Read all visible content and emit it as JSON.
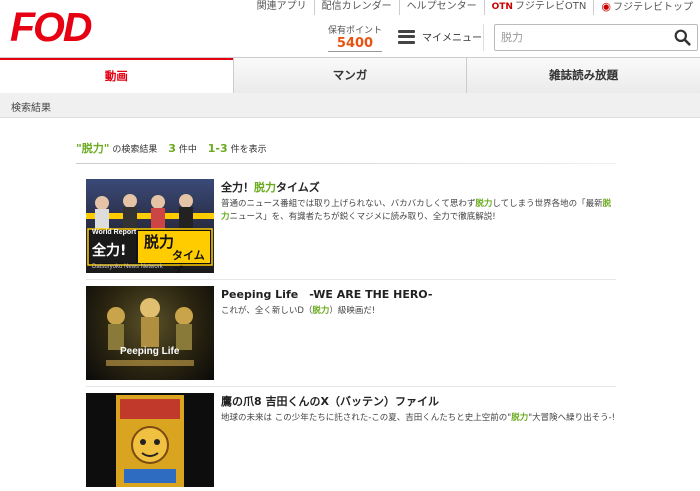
{
  "header": {
    "logo": "FOD",
    "links": [
      "関連アプリ",
      "配信カレンダー",
      "ヘルプセンター"
    ],
    "otn_badge": "OTN",
    "otn_label": "フジテレビOTN",
    "fuji_label": "フジテレビトップ",
    "points_label": "保有ポイント",
    "points_value": "5400",
    "menu_label": "マイメニュー"
  },
  "search": {
    "value": "脱力"
  },
  "tabs": [
    "動画",
    "マンガ",
    "雑誌読み放題"
  ],
  "breadcrumb": "検索結果",
  "summary": {
    "query": "\"脱力\"",
    "label": "の検索結果",
    "total": "3",
    "total_unit": "件中",
    "range": "1-3",
    "range_unit": "件を表示"
  },
  "results": [
    {
      "title_pre": "全力！",
      "title_hl": "脱力",
      "title_post": "タイムズ",
      "desc_1": "普通のニュース番組では取り上げられない、バカバカしくて思わず",
      "desc_hl1": "脱力",
      "desc_2": "してしまう世界各地の「最新",
      "desc_hl2": "脱力",
      "desc_3": "ニュース」を、有識者たちが鋭くマジメに読み取り、全力で徹底解説!",
      "thumb_line1": "World Report",
      "thumb_big": "全力!",
      "thumb_big2": "脱力",
      "thumb_big3": "タイムズ",
      "thumb_caption": "Datsuryoku News Network"
    },
    {
      "title": "Peeping Life　-WE ARE THE HERO-",
      "desc_1": "これが、全く新しいD（",
      "desc_hl1": "脱力",
      "desc_2": "）級映画だ!",
      "thumb_text": "Peeping Life"
    },
    {
      "title": "鷹の爪8 吉田くんのX（バッテン）ファイル",
      "desc_1": "地球の未来は この少年たちに託された-この夏、吉田くんたちと史上空前の\"",
      "desc_hl1": "脱力",
      "desc_2": "\"大冒険へ繰り出そう-!"
    }
  ],
  "colors": {
    "brand": "#e60012",
    "highlight": "#6aaa1e",
    "points": "#e8530f"
  },
  "icons": {
    "search": "search-icon",
    "menu": "hamburger-icon"
  }
}
